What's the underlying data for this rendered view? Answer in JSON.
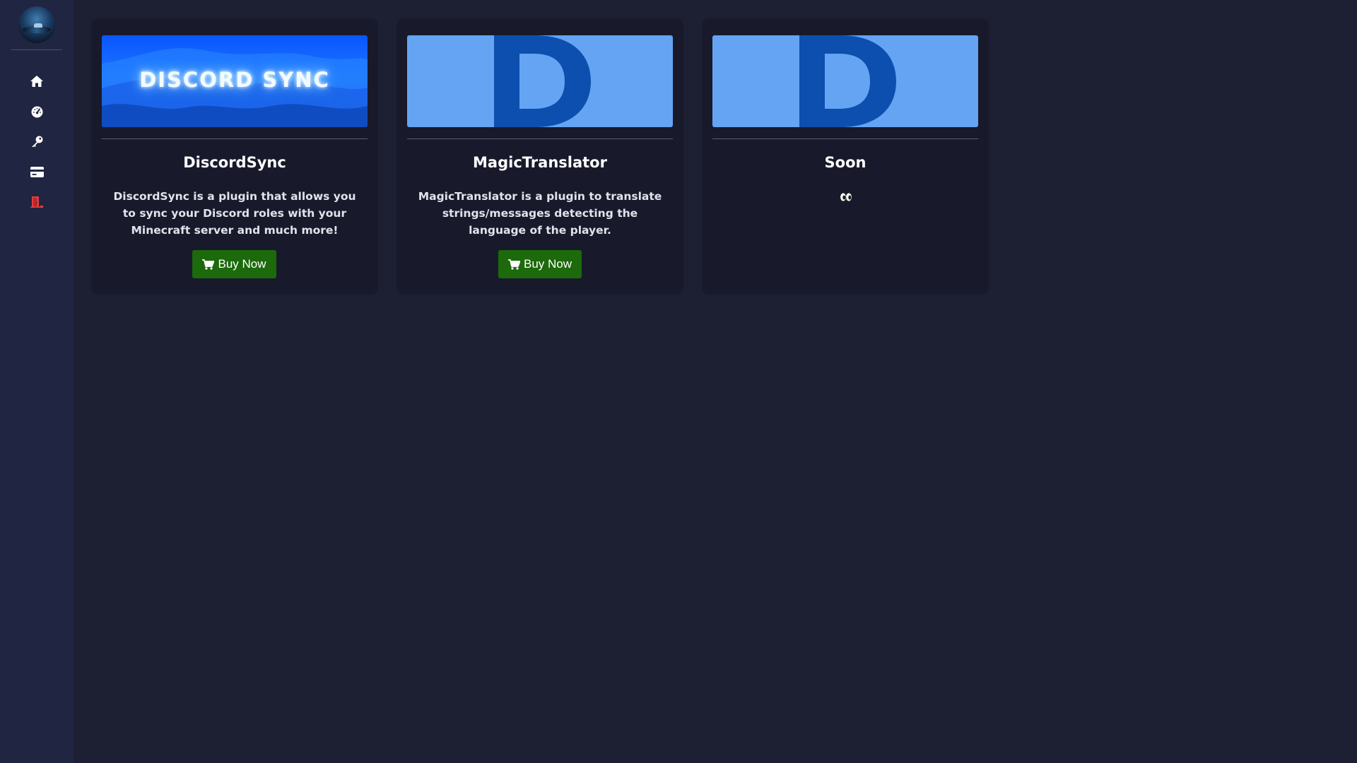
{
  "sidebar": {
    "avatar_icon": "user-avatar",
    "items": [
      {
        "icon": "home-icon"
      },
      {
        "icon": "dashboard-icon"
      },
      {
        "icon": "key-icon"
      },
      {
        "icon": "credit-card-icon"
      },
      {
        "icon": "logout-icon",
        "color": "#e53e3e"
      }
    ]
  },
  "products": [
    {
      "banner_text": "DISCORD SYNC",
      "title": "DiscordSync",
      "description": "DiscordSync is a plugin that allows you to sync your Discord roles with your Minecraft server and much more!",
      "button_label": "Buy Now"
    },
    {
      "banner_letter": "D",
      "title": "MagicTranslator",
      "description": "MagicTranslator is a plugin to translate strings/messages detecting the language of the player.",
      "button_label": "Buy Now"
    },
    {
      "banner_letter": "D",
      "title": "Soon",
      "description_icon": "eyes-icon"
    }
  ],
  "colors": {
    "background": "#1d2033",
    "sidebar": "#202541",
    "card": "#181a2b",
    "button": "#1c6a0b",
    "banner_light": "#64a4f2",
    "banner_dark": "#0d4fae"
  }
}
